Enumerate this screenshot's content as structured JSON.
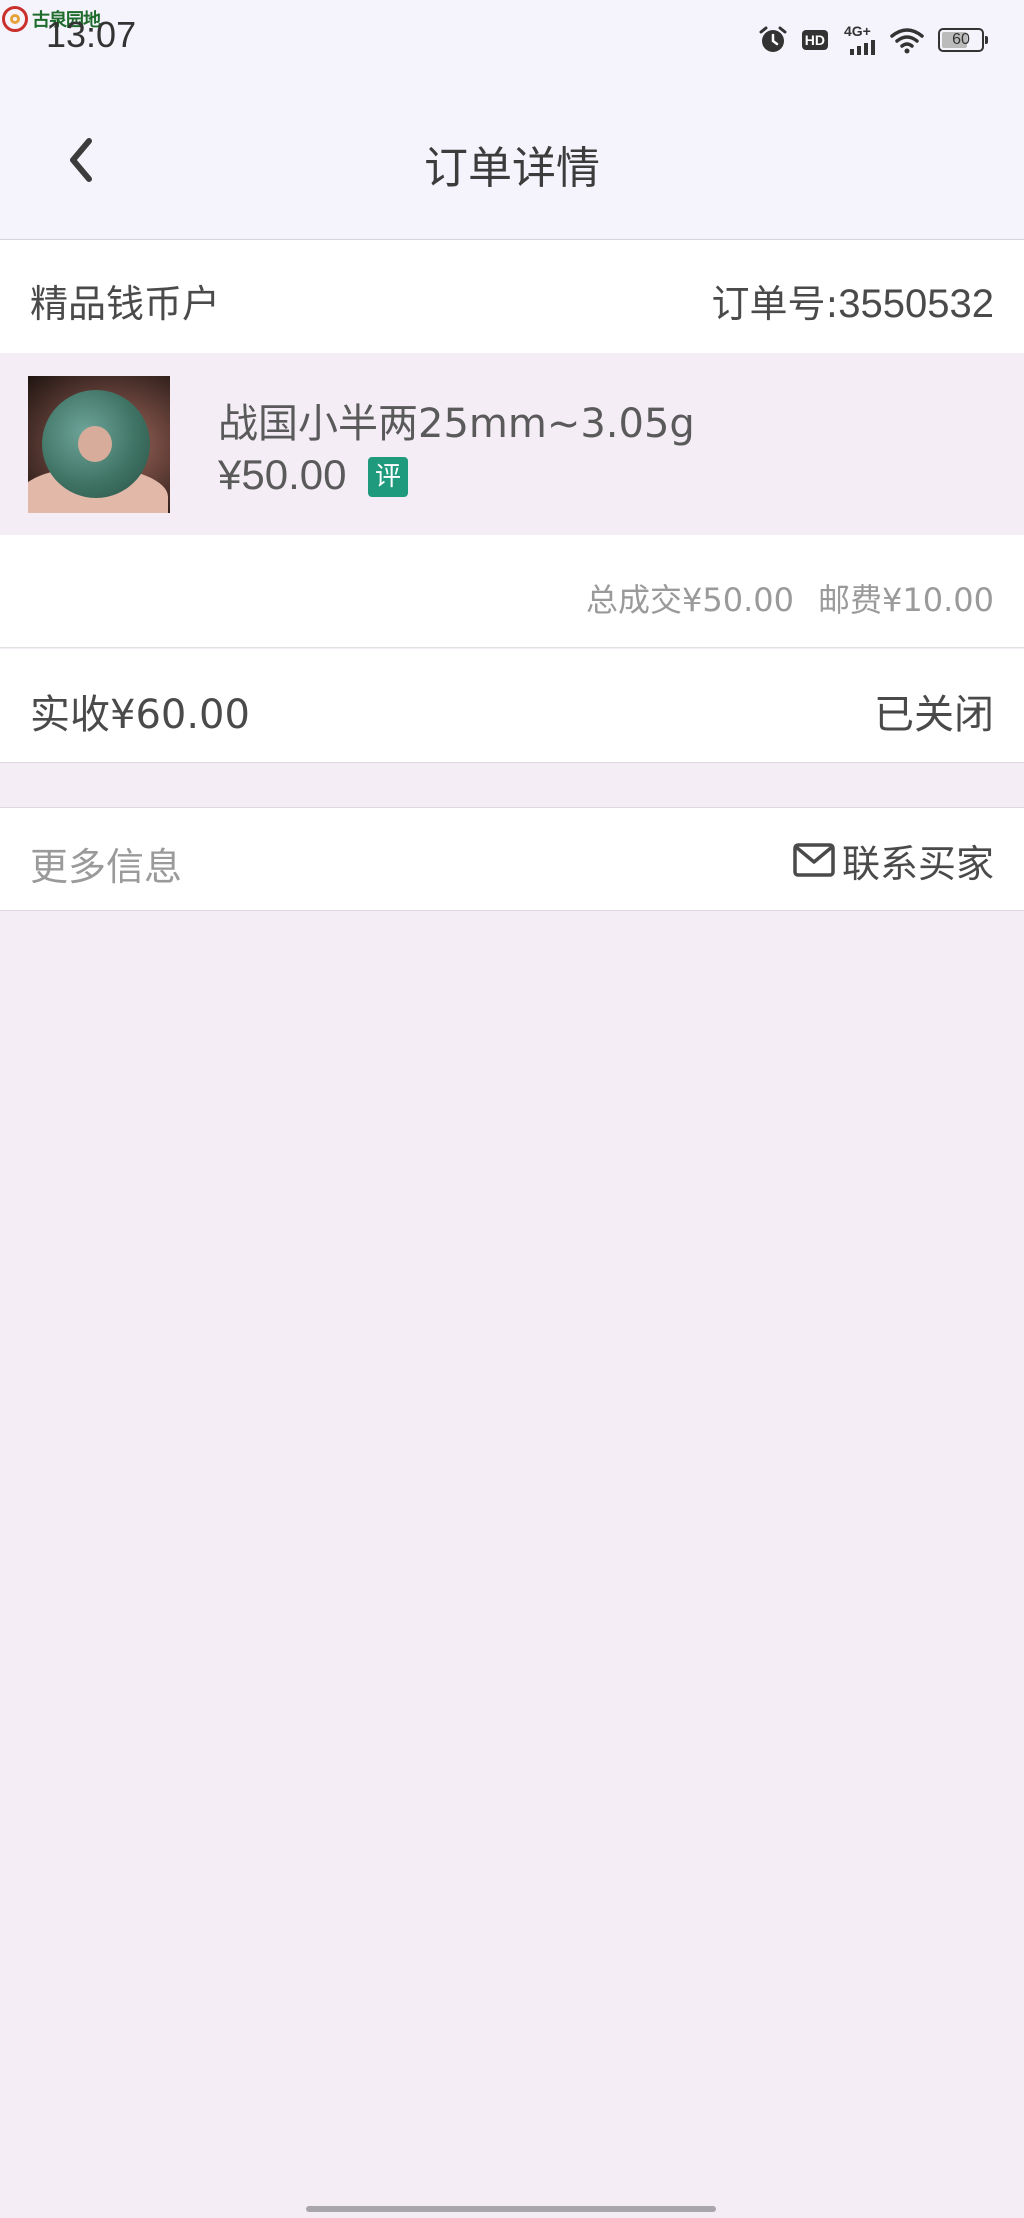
{
  "status_bar": {
    "watermark": "古泉园地",
    "time": "13:07",
    "hd_label": "HD",
    "network_label": "4G+",
    "battery_percent": "60"
  },
  "header": {
    "title": "订单详情",
    "back_icon": "chevron-left-icon"
  },
  "order": {
    "shop_name": "精品钱币户",
    "order_number_label": "订单号:",
    "order_number": "3550532",
    "product": {
      "name": "战国小半两25mm~3.05g",
      "price": "¥50.00",
      "badge": "评",
      "badge_color": "#1f9a7d"
    },
    "total_deal": "总成交¥50.00",
    "shipping_fee": "邮费¥10.00",
    "received": "实收¥60.00",
    "status": "已关闭"
  },
  "more": {
    "label": "更多信息",
    "contact_label": "联系买家",
    "contact_icon": "mail-icon"
  }
}
